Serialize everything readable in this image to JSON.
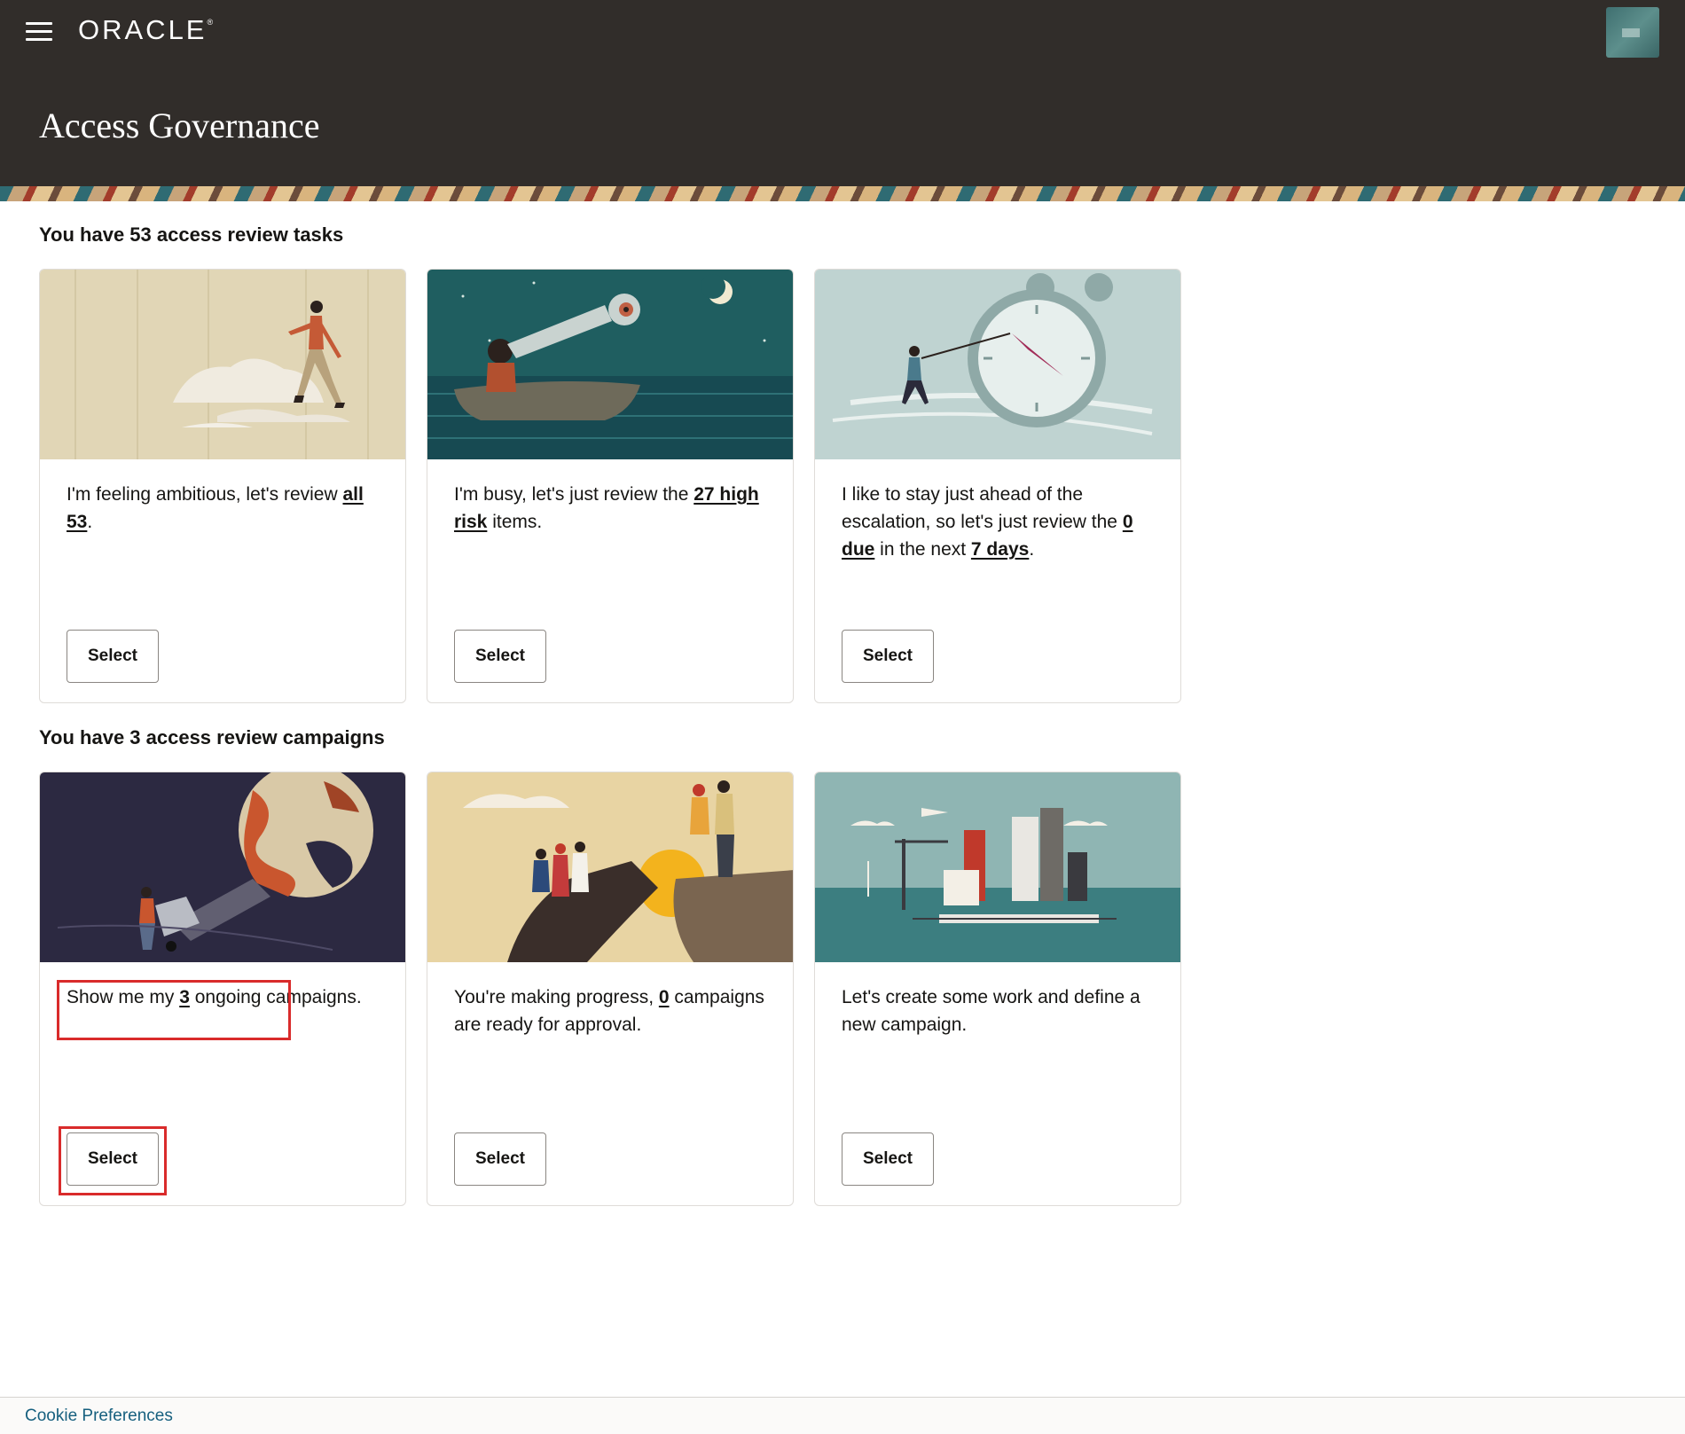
{
  "header": {
    "brand": "ORACLE",
    "brand_mark": "®",
    "title": "Access Governance",
    "menu_icon": "hamburger-menu-icon",
    "avatar_icon": "user-avatar-icon"
  },
  "tasks_section": {
    "heading": "You have 53 access review tasks",
    "cards": [
      {
        "illustration": "person-climbing-clouds-illustration",
        "text_before": "I'm feeling ambitious, let's review ",
        "link1": "all 53",
        "text_after": ".",
        "button": "Select"
      },
      {
        "illustration": "person-telescope-boat-illustration",
        "text_before": "I'm busy, let's just review the ",
        "link1": "27 high risk",
        "text_after": " items.",
        "button": "Select"
      },
      {
        "illustration": "person-pulling-clock-illustration",
        "text_before": "I like to stay just ahead of the escalation, so let's just review the ",
        "link1": "0 due",
        "text_mid": " in the next ",
        "link2": "7 days",
        "text_after": ".",
        "button": "Select"
      }
    ]
  },
  "campaigns_section": {
    "heading": "You have 3 access review campaigns",
    "cards": [
      {
        "illustration": "person-flashlight-planet-illustration",
        "text_before": "Show me my ",
        "link1": "3",
        "text_after": " ongoing campaigns.",
        "button": "Select"
      },
      {
        "illustration": "people-on-cliff-illustration",
        "text_before": "You're making progress, ",
        "link1": "0",
        "text_after": " campaigns are ready for approval.",
        "button": "Select"
      },
      {
        "illustration": "city-skyline-illustration",
        "text_before": "Let's create some work and define a new campaign.",
        "button": "Select"
      }
    ]
  },
  "footer": {
    "cookie_link": "Cookie Preferences"
  },
  "colors": {
    "header_bg": "#312d2a",
    "highlight": "#d92b2b",
    "footer_link": "#17607f"
  }
}
